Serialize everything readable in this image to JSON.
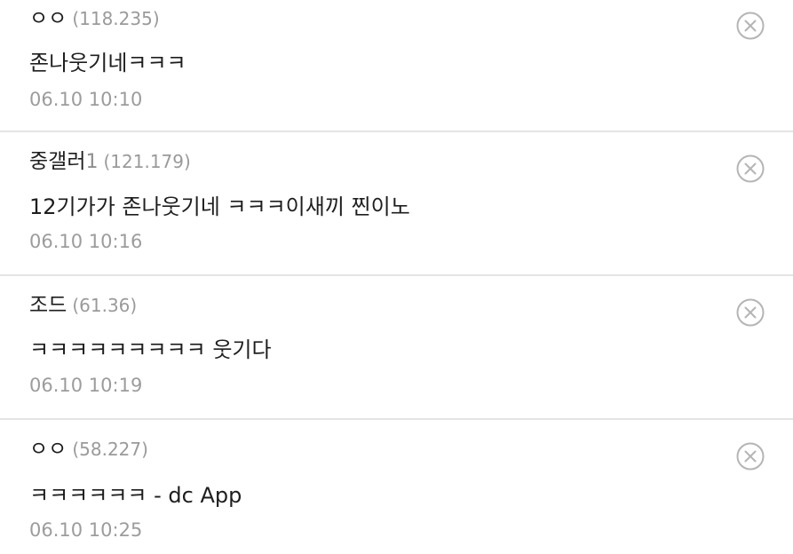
{
  "comments": [
    {
      "nickname": "ㅇㅇ",
      "nickname_suffix": "",
      "ip": "(118.235)",
      "text": "존나웃기네ㅋㅋㅋ",
      "date": "06.10 10:10",
      "delete_icon": "circle-x-icon"
    },
    {
      "nickname": "중갤러",
      "nickname_suffix": "1",
      "ip": "(121.179)",
      "text": "12기가가 존나웃기네 ㅋㅋㅋ이새끼 찐이노",
      "date": "06.10 10:16",
      "delete_icon": "circle-x-icon"
    },
    {
      "nickname": "조드",
      "nickname_suffix": "",
      "ip": "(61.36)",
      "text": "ㅋㅋㅋㅋㅋㅋㅋㅋㅋ 웃기다",
      "date": "06.10 10:19",
      "delete_icon": "circle-x-icon"
    },
    {
      "nickname": "ㅇㅇ",
      "nickname_suffix": "",
      "ip": "(58.227)",
      "text": "ㅋㅋㅋㅋㅋㅋ - dc App",
      "date": "06.10 10:25",
      "delete_icon": "circle-x-icon"
    }
  ],
  "colors": {
    "nickname": "#1e1e1e",
    "ip": "#9a9a9a",
    "date": "#9c9c9c",
    "divider": "#e4e4e4",
    "delete_icon": "#b5b5b5"
  }
}
